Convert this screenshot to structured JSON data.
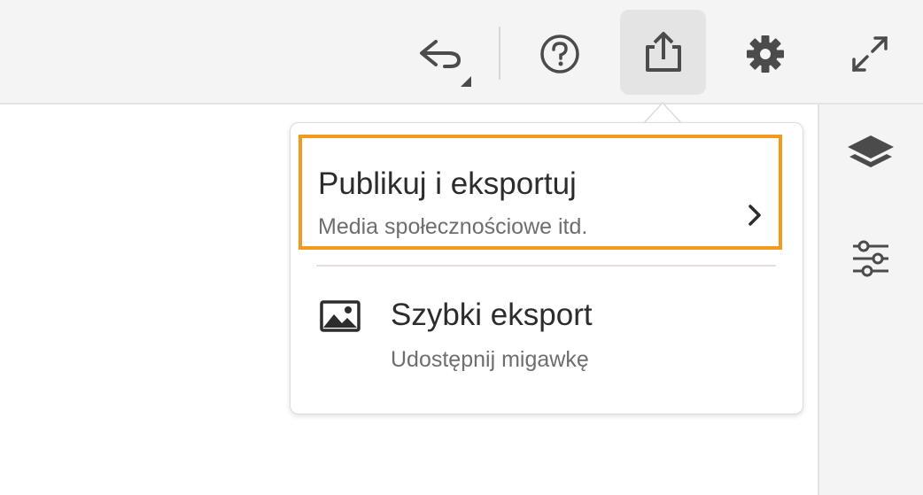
{
  "toolbar": {
    "icons": [
      "undo-icon",
      "help-icon",
      "share-icon",
      "gear-icon",
      "fullscreen-icon"
    ]
  },
  "sidebar": {
    "icons": [
      "layers-icon",
      "adjustments-icon"
    ]
  },
  "share_menu": {
    "items": [
      {
        "title": "Publikuj i eksportuj",
        "subtitle": "Media społecznościowe itd.",
        "icon": "chevron-right-icon",
        "highlighted": true
      },
      {
        "title": "Szybki eksport",
        "subtitle": "Udostępnij migawkę",
        "icon": "image-icon"
      }
    ]
  },
  "colors": {
    "highlight": "#f29a1e",
    "toolbar_bg": "#f4f4f4",
    "icon": "#4b4b4b"
  }
}
